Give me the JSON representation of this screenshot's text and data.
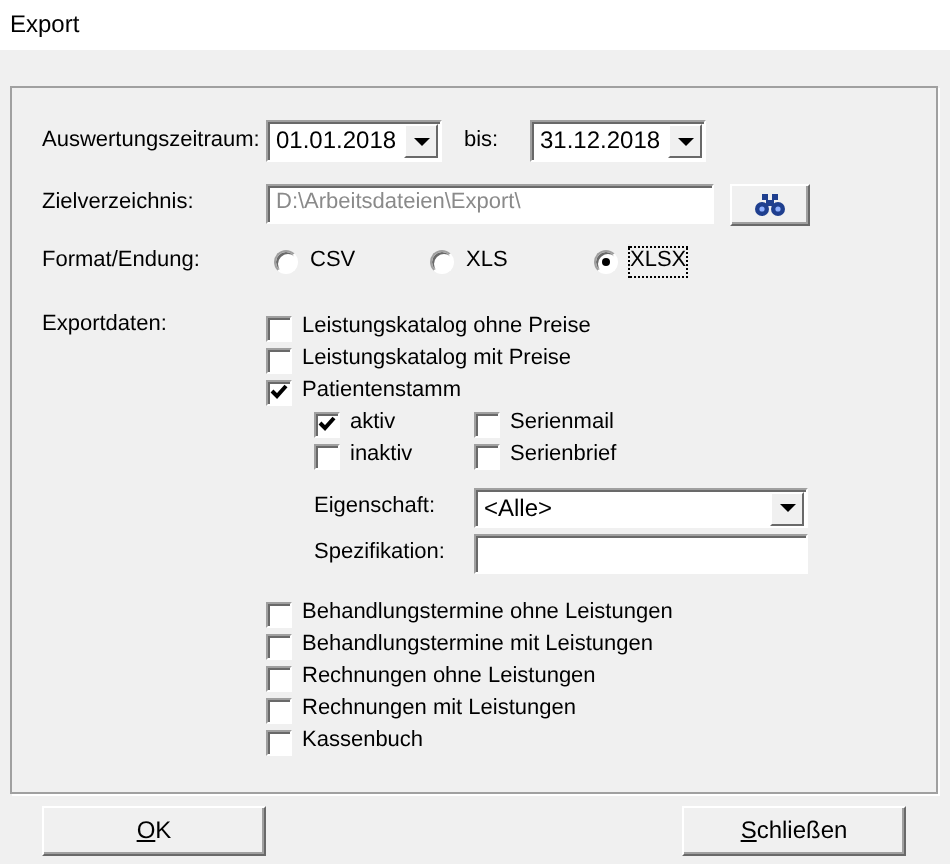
{
  "window": {
    "title": "Export"
  },
  "period": {
    "label": "Auswertungszeitraum:",
    "from": "01.01.2018",
    "to_label": "bis:",
    "to": "31.12.2018"
  },
  "target": {
    "label": "Zielverzeichnis:",
    "value": "D:\\Arbeitsdateien\\Export\\",
    "disabled": true
  },
  "format": {
    "label": "Format/Endung:",
    "options": [
      {
        "label": "CSV",
        "selected": false,
        "focused": false
      },
      {
        "label": "XLS",
        "selected": false,
        "focused": false
      },
      {
        "label": "XLSX",
        "selected": true,
        "focused": true
      }
    ]
  },
  "export_data": {
    "label": "Exportdaten:",
    "items": [
      {
        "label": "Leistungskatalog ohne Preise",
        "checked": false
      },
      {
        "label": "Leistungskatalog mit Preise",
        "checked": false
      },
      {
        "label": "Patientenstamm",
        "checked": true
      }
    ],
    "patient_options": [
      {
        "label": "aktiv",
        "checked": true
      },
      {
        "label": "Serienmail",
        "checked": false
      },
      {
        "label": "inaktiv",
        "checked": false
      },
      {
        "label": "Serienbrief",
        "checked": false
      }
    ],
    "property": {
      "label": "Eigenschaft:",
      "value": "<Alle>"
    },
    "specification": {
      "label": "Spezifikation:"
    },
    "more_items": [
      {
        "label": "Behandlungstermine ohne Leistungen",
        "checked": false
      },
      {
        "label": "Behandlungstermine mit Leistungen",
        "checked": false
      },
      {
        "label": "Rechnungen ohne Leistungen",
        "checked": false
      },
      {
        "label": "Rechnungen mit Leistungen",
        "checked": false
      },
      {
        "label": "Kassenbuch",
        "checked": false
      }
    ]
  },
  "buttons": [
    {
      "mnemonic": "O",
      "rest": "K"
    },
    {
      "mnemonic": "S",
      "rest": "chließen"
    }
  ]
}
